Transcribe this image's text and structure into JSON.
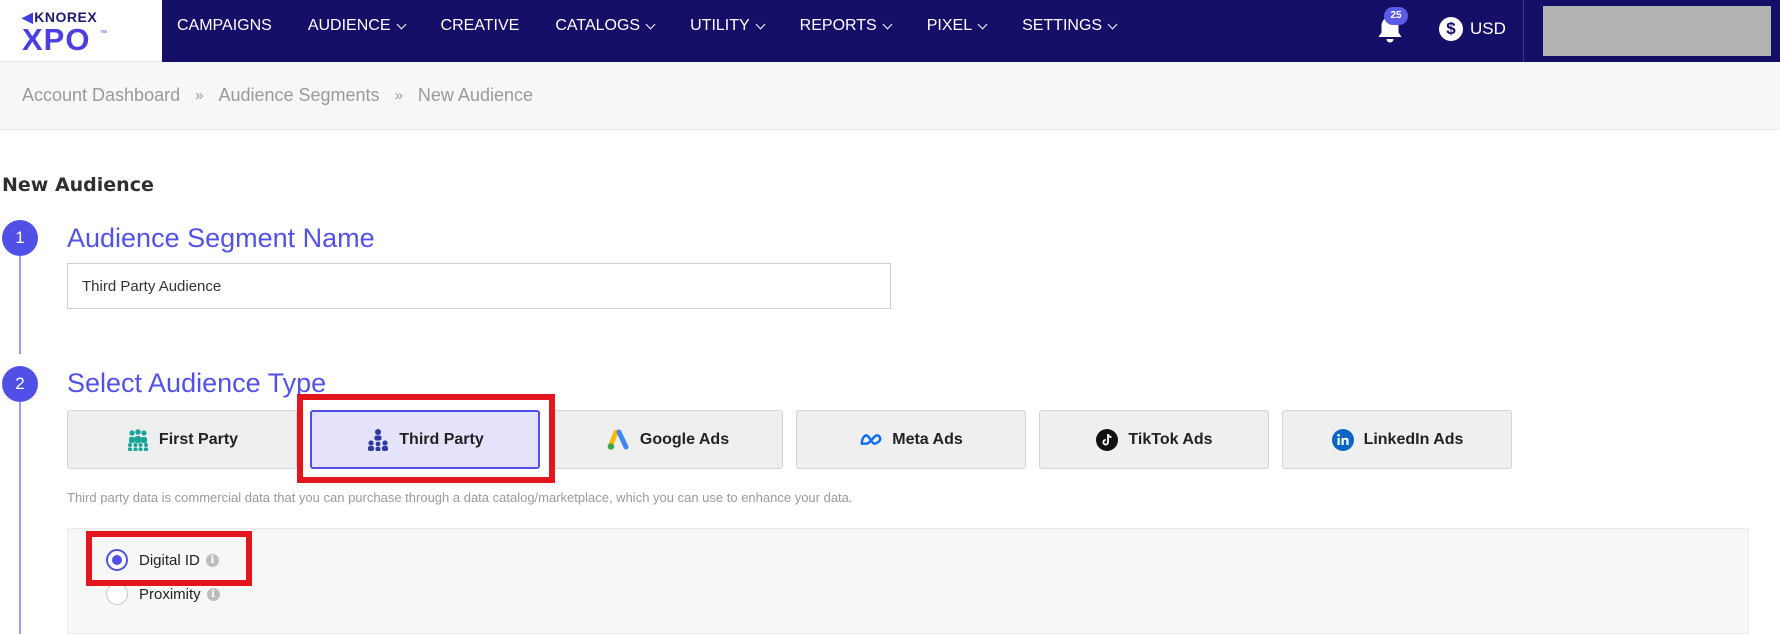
{
  "brand": {
    "company": "KNOREX",
    "product": "XPO",
    "trademark": "™"
  },
  "nav": {
    "items": [
      {
        "label": "CAMPAIGNS",
        "dropdown": false
      },
      {
        "label": "AUDIENCE",
        "dropdown": true
      },
      {
        "label": "CREATIVE",
        "dropdown": false
      },
      {
        "label": "CATALOGS",
        "dropdown": true
      },
      {
        "label": "UTILITY",
        "dropdown": true
      },
      {
        "label": "REPORTS",
        "dropdown": true
      },
      {
        "label": "PIXEL",
        "dropdown": true
      },
      {
        "label": "SETTINGS",
        "dropdown": true
      }
    ],
    "notification_count": "25",
    "currency_symbol": "$",
    "currency": "USD"
  },
  "breadcrumb": {
    "items": [
      "Account Dashboard",
      "Audience Segments",
      "New Audience"
    ],
    "separator": "»"
  },
  "page": {
    "title": "New Audience"
  },
  "step1": {
    "number": "1",
    "heading": "Audience Segment Name",
    "input_value": "Third Party Audience"
  },
  "step2": {
    "number": "2",
    "heading": "Select Audience Type",
    "types": [
      {
        "label": "First Party",
        "icon": "group-icon",
        "selected": false
      },
      {
        "label": "Third Party",
        "icon": "hierarchy-icon",
        "selected": true
      },
      {
        "label": "Google Ads",
        "icon": "google-ads-icon",
        "selected": false
      },
      {
        "label": "Meta Ads",
        "icon": "meta-icon",
        "selected": false
      },
      {
        "label": "TikTok Ads",
        "icon": "tiktok-icon",
        "selected": false
      },
      {
        "label": "LinkedIn Ads",
        "icon": "linkedin-icon",
        "selected": false
      }
    ],
    "description": "Third party data is commercial data that you can purchase through a data catalog/marketplace, which you can use to enhance your data.",
    "options": [
      {
        "label": "Digital ID",
        "checked": true
      },
      {
        "label": "Proximity",
        "checked": false
      }
    ]
  },
  "colors": {
    "nav_bg": "#150f67",
    "accent": "#5050e6",
    "highlight": "#e3161d"
  }
}
